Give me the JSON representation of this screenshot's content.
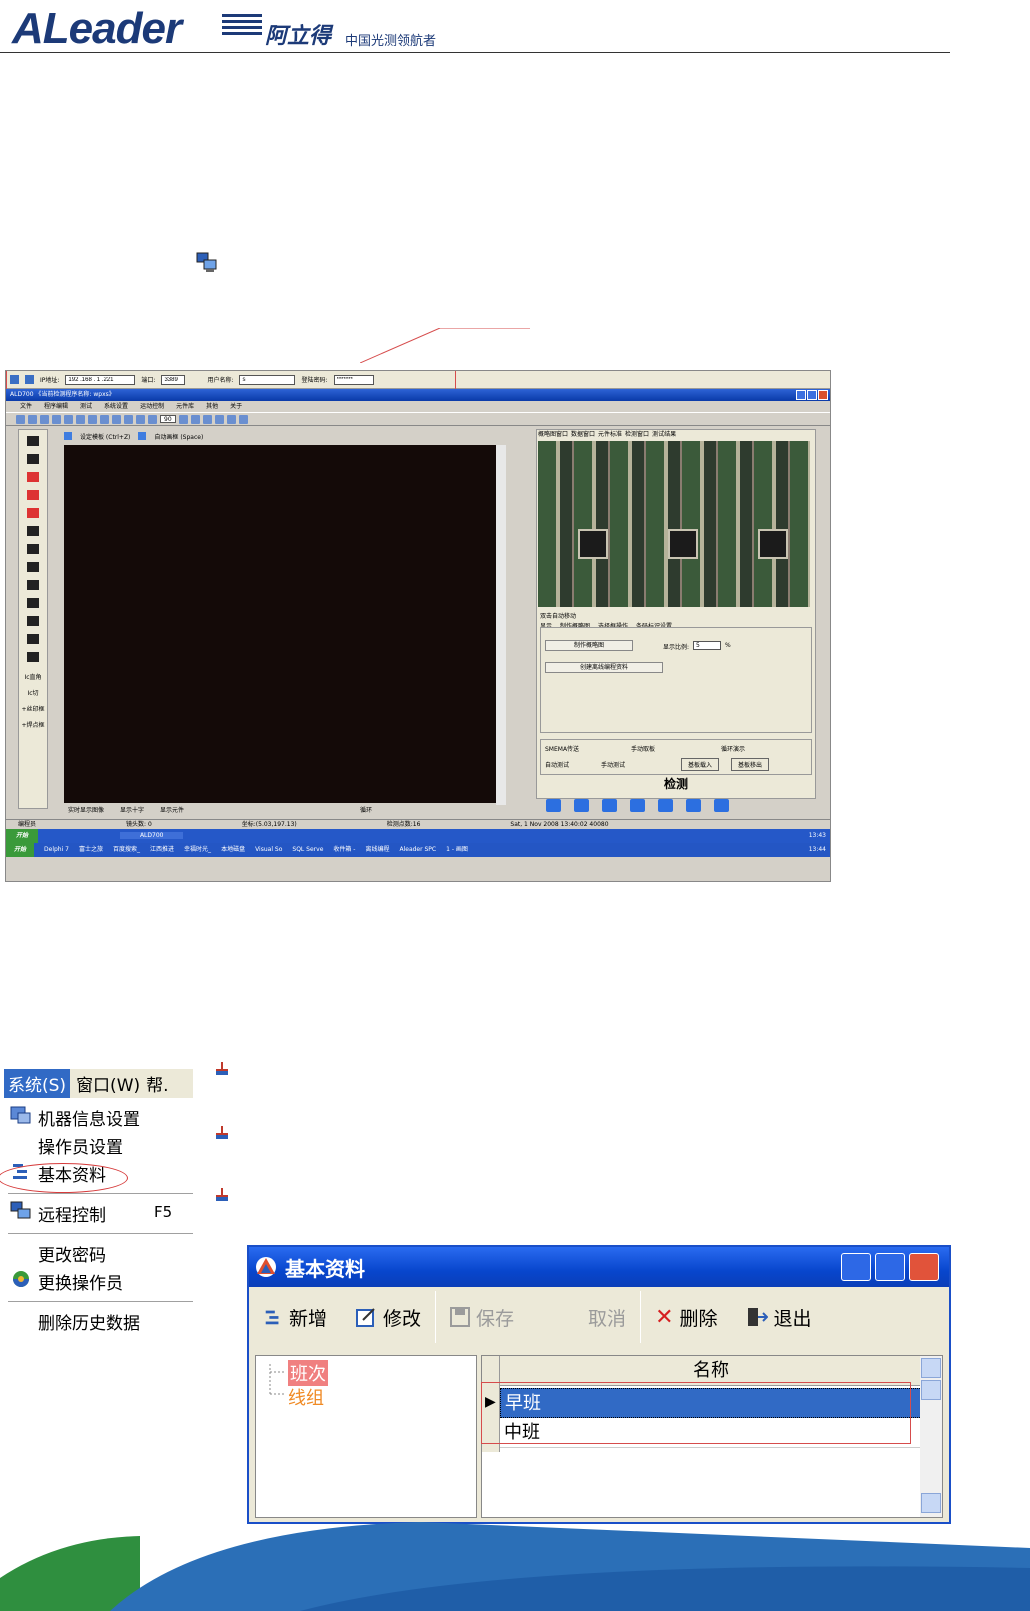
{
  "header": {
    "brand": "ALeader",
    "brand_cn": "阿立得",
    "tagline": "中国光测领航者"
  },
  "screenshot": {
    "connection": {
      "ip_label": "IP地址:",
      "ip_value": "192 .168 . 1 .221",
      "port_label": "端口:",
      "port_value": "3389",
      "user_label": "用户名称:",
      "user_value": "s",
      "password_label": "登陆密码:",
      "password_value": "*******"
    },
    "window_title": "ALD700 《当前检测程序名称: wpxs》",
    "menu": [
      "文件",
      "程序编辑",
      "测试",
      "系统设置",
      "运动控制",
      "元件库",
      "其他",
      "关于"
    ],
    "zoom": "90",
    "view_top": {
      "template": "设定模板 (Ctrl+Z)",
      "auto_frame": "自动画框 (Space)"
    },
    "left_tools": [
      "Ic直角",
      "Ic切",
      "+丝印框",
      "+焊点框"
    ],
    "right_tabs": [
      "概略图窗口",
      "数据窗口",
      "元件标准",
      "检测窗口",
      "测试结果"
    ],
    "auto_move": "双击自动移动",
    "sub_tabs": [
      "显示",
      "制作概略图",
      "选择框操作",
      "条码标识设置"
    ],
    "make_overview": "制作概略图",
    "scale_label": "显示比例:",
    "scale_value": "5",
    "scale_unit": "%",
    "create_offline": "创建离线编程资料",
    "modes": [
      "SMEMA传送",
      "手动取板",
      "循环演示",
      "自动测试",
      "手动测试"
    ],
    "board_in": "基板载入",
    "board_out": "基板移出",
    "detect": "检测",
    "bottom_checks": [
      "实时显示图像",
      "显示十字",
      "显示元件",
      "循环"
    ],
    "status": [
      "编程员",
      "镜头数: 0",
      "坐标:(5.03,197.13)",
      "检测点数:16",
      "Sat, 1 Nov 2008 13:40:02 40080"
    ],
    "taskbar1": {
      "start": "开始",
      "app": "ALD700",
      "clock": "13:43"
    },
    "taskbar2": {
      "start": "开始",
      "items": [
        "Delphi 7",
        "富士之旅",
        "百度搜索_",
        "江西推进",
        "幸福时光_",
        "本地磁盘",
        "Visual So",
        "SQL Serve",
        "收件箱 -",
        "离线编程",
        "Aleader SPC",
        "1 - 画图"
      ],
      "clock": "13:44"
    }
  },
  "system_menu": {
    "bar": [
      "系统(S)",
      "窗口(W)",
      "帮."
    ],
    "items": [
      "机器信息设置",
      "操作员设置",
      "基本资料",
      "远程控制",
      "更改密码",
      "更换操作员",
      "删除历史数据"
    ],
    "shortcut": "F5"
  },
  "dialog": {
    "title": "基本资料",
    "toolbar": {
      "add": "新增",
      "edit": "修改",
      "save": "保存",
      "cancel": "取消",
      "delete": "删除",
      "exit": "退出"
    },
    "tree": [
      "班次",
      "线组"
    ],
    "grid_header": "名称",
    "rows": [
      "早班",
      "中班"
    ]
  },
  "colors": {
    "brand_blue": "#1c3a78",
    "xp_blue": "#0a46cd",
    "selection": "#316ac5",
    "annotation_red": "#d64c4c",
    "tree_highlight": "#f08080",
    "tree_orange": "#f08a24",
    "swoosh_green": "#2f8f3f",
    "swoosh_blue": "#2b6fb7"
  }
}
